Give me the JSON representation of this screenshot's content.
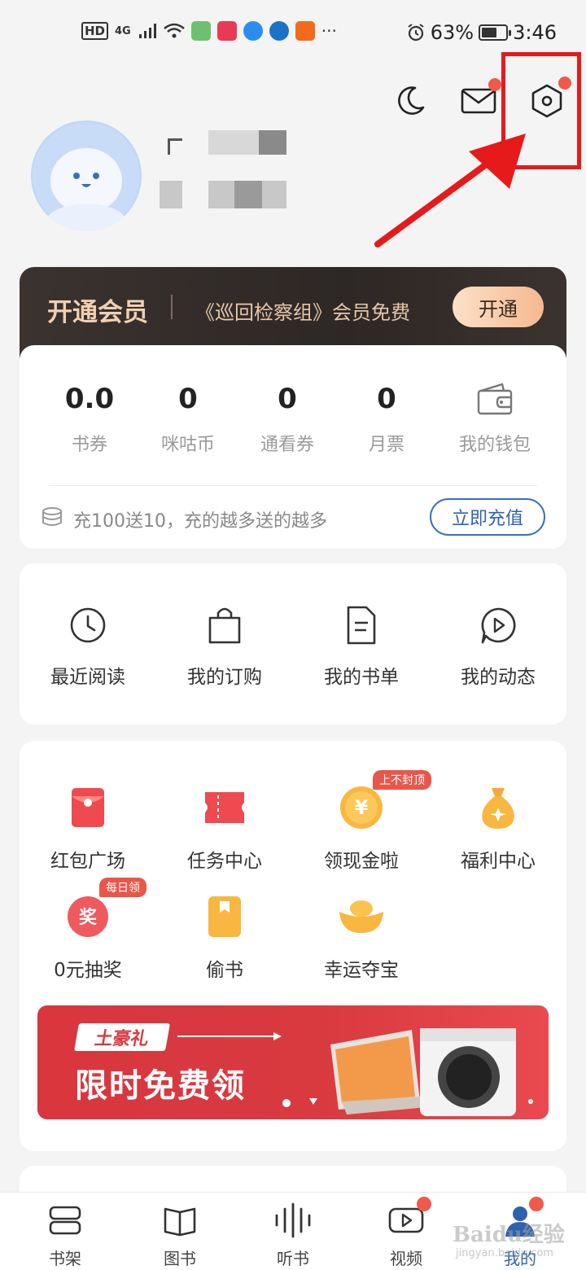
{
  "status_bar": {
    "network": "HD",
    "signal": "4G",
    "battery_percent": "63%",
    "battery_level": 0.63,
    "time": "3:46",
    "more": "···"
  },
  "header": {
    "icons": [
      "moon-icon",
      "mail-icon",
      "settings-icon"
    ]
  },
  "vip": {
    "title": "开通会员",
    "desc": "《巡回检察组》会员免费",
    "button": "开通"
  },
  "wallet": {
    "stats": [
      {
        "value": "0.0",
        "label": "书券"
      },
      {
        "value": "0",
        "label": "咪咕币"
      },
      {
        "value": "0",
        "label": "通看券"
      },
      {
        "value": "0",
        "label": "月票"
      }
    ],
    "wallet_label": "我的钱包",
    "recharge_text": "充100送10，充的越多送的越多",
    "recharge_button": "立即充值"
  },
  "menu": [
    {
      "label": "最近阅读",
      "icon": "clock-icon"
    },
    {
      "label": "我的订购",
      "icon": "shopping-bag-icon"
    },
    {
      "label": "我的书单",
      "icon": "document-icon"
    },
    {
      "label": "我的动态",
      "icon": "play-bubble-icon"
    }
  ],
  "welfare": [
    {
      "label": "红包广场",
      "icon": "red-envelope-icon"
    },
    {
      "label": "任务中心",
      "icon": "ticket-icon"
    },
    {
      "label": "领现金啦",
      "icon": "gold-coin-icon",
      "tag": "上不封顶"
    },
    {
      "label": "福利中心",
      "icon": "money-bag-icon"
    },
    {
      "label": "0元抽奖",
      "icon": "prize-icon",
      "tag": "每日领",
      "glyph": "奖"
    },
    {
      "label": "偷书",
      "icon": "book-icon"
    },
    {
      "label": "幸运夺宝",
      "icon": "gold-ingot-icon"
    }
  ],
  "coin_glyph": "¥",
  "banner": {
    "tag": "土豪礼",
    "headline": "限时免费领"
  },
  "tabs": [
    {
      "label": "书架",
      "icon": "bookshelf-icon"
    },
    {
      "label": "图书",
      "icon": "open-book-icon"
    },
    {
      "label": "听书",
      "icon": "sound-wave-icon"
    },
    {
      "label": "视频",
      "icon": "video-icon"
    },
    {
      "label": "我的",
      "icon": "profile-icon",
      "active": true
    }
  ],
  "watermark": {
    "main": "Baidu经验",
    "sub": "jingyan.baidu.com"
  },
  "colors": {
    "accent_blue": "#2f62ad",
    "badge_red": "#ef5a4b",
    "vip_gold": "#f1cfb2",
    "banner_red": "#d83a40"
  }
}
